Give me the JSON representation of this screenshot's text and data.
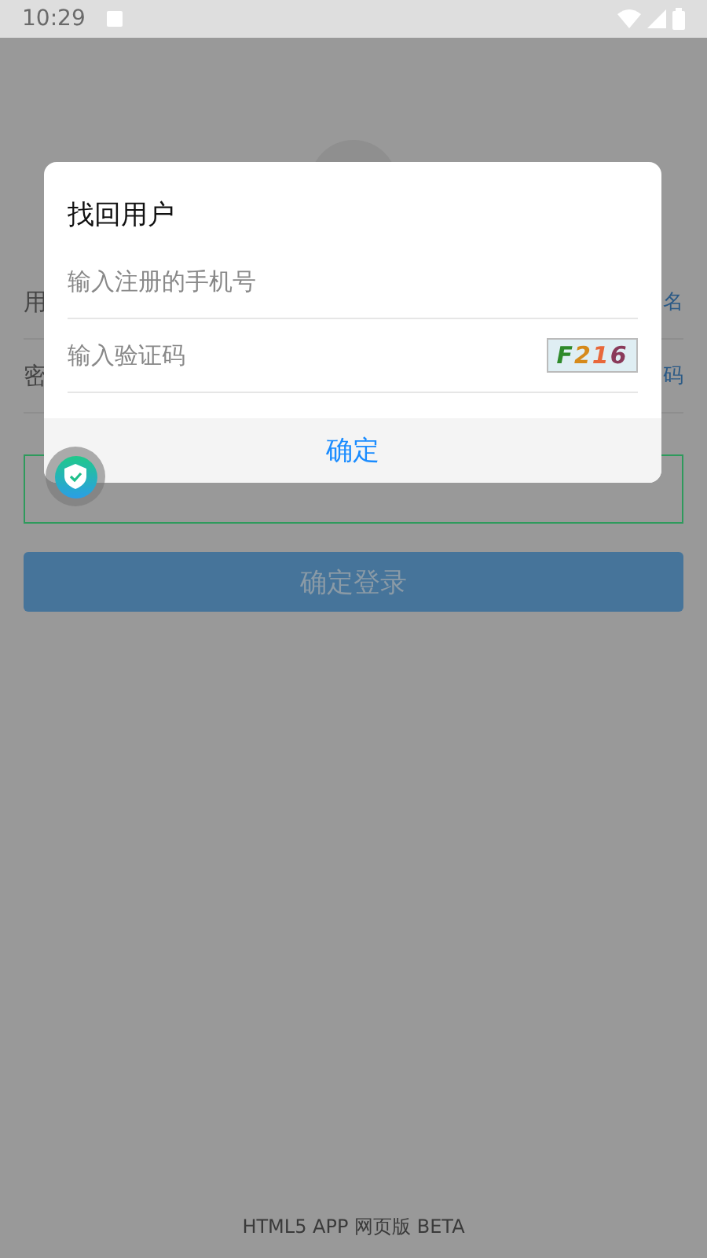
{
  "status_bar": {
    "time": "10:29"
  },
  "login_form": {
    "username_label": "用",
    "username_action": "名",
    "password_label": "密",
    "password_action": "码",
    "submit": "确定登录"
  },
  "footer": "HTML5 APP 网页版 BETA",
  "dialog": {
    "title": "找回用户",
    "fields": [
      {
        "placeholder": "输入注册的手机号"
      },
      {
        "placeholder": "输入验证码",
        "captcha": "F216"
      }
    ],
    "confirm": "确定"
  }
}
